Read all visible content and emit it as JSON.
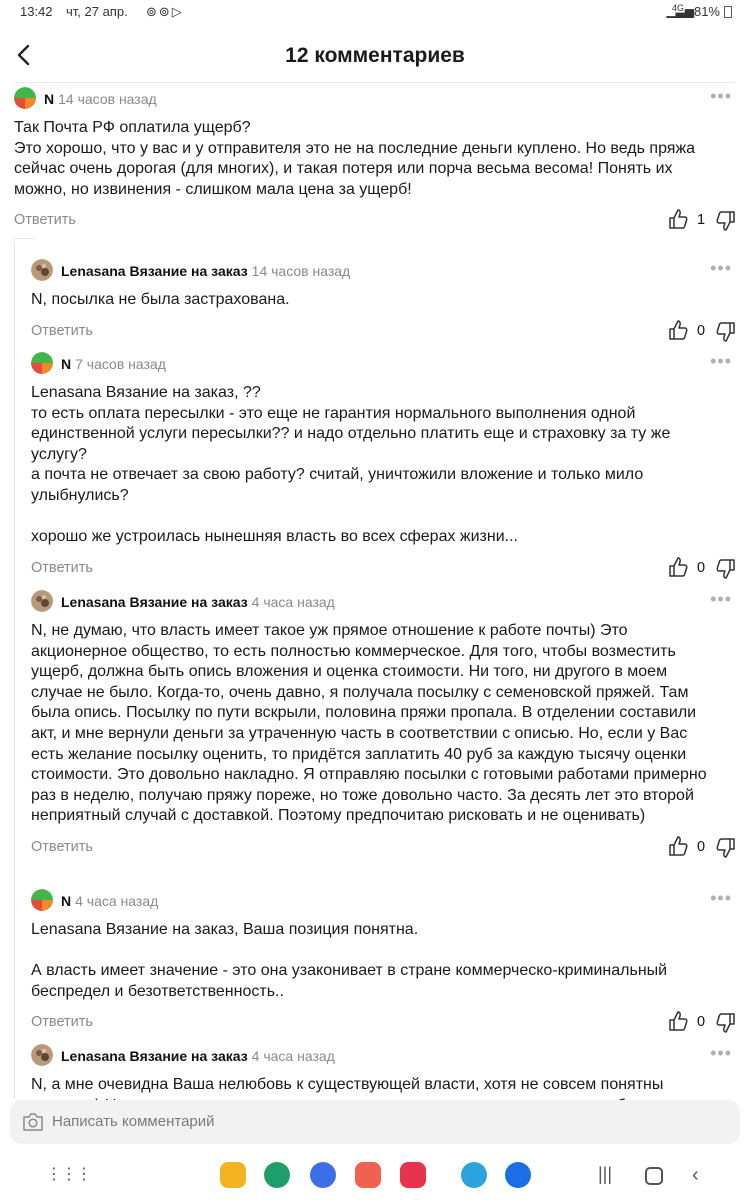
{
  "status_bar": {
    "time": "13:42",
    "date": "чт, 27 апр.",
    "battery": "81%",
    "network": "4G"
  },
  "header": {
    "title": "12 комментариев"
  },
  "comments": [
    {
      "author": "N",
      "time": "14 часов назад",
      "text": "Так Почта РФ оплатила ущерб?\nЭто хорошо, что у вас и у отправителя это не на последние деньги куплено. Но ведь пряжа сейчас очень дорогая (для многих), и такая потеря или порча весьма весома! Понять их можно, но извинения - слишком мала цена за ущерб!",
      "reply": "Ответить",
      "likes": "1"
    },
    {
      "author": "Lenasana Вязание на заказ",
      "time": "14 часов назад",
      "text": "N, посылка  не была застрахована.",
      "reply": "Ответить",
      "likes": "0"
    },
    {
      "author": "N",
      "time": "7 часов назад",
      "text": "Lenasana Вязание на заказ, ??\nто есть оплата пересылки - это еще не гарантия нормального выполнения одной единственной услуги пересылки?? и надо отдельно платить еще и страховку за ту же услугу?\nа почта не отвечает за свою работу? считай, уничтожили вложение и только мило улыбнулись?\n\nхорошо же устроилась нынешняя власть во всех сферах жизни...",
      "reply": "Ответить",
      "likes": "0"
    },
    {
      "author": "Lenasana Вязание на заказ",
      "time": "4 часа назад",
      "text": "N, не думаю, что власть имеет такое уж прямое отношение к работе почты) Это акционерное общество,  то есть полностью коммерческое. Для того,  чтобы возместить ущерб, должна быть опись вложения и оценка стоимости.  Ни того, ни другого в моем случае не было. Когда-то,  очень давно, я получала посылку с семеновской пряжей. Там была опись. Посылку по пути вскрыли, половина пряжи пропала. В отделении составили акт, и мне вернули деньги за утраченную часть в соответствии с описью. Но, если у Вас есть желание посылку оценить,  то придётся заплатить 40 руб за каждую тысячу оценки стоимости. Это довольно накладно. Я отправляю посылки с готовыми работами примерно раз в неделю,  получаю пряжу пореже, но тоже довольно часто. За десять лет это второй неприятный случай с доставкой. Поэтому предпочитаю рисковать и не оценивать)",
      "reply": "Ответить",
      "likes": "0"
    },
    {
      "author": "N",
      "time": "4 часа назад",
      "text": "Lenasana Вязание на заказ, Ваша позиция понятна.\n\nА власть имеет значение - это она узаконивает в стране коммерческо-криминальный беспредел и безответственность..",
      "reply": "Ответить",
      "likes": "0"
    },
    {
      "author": "Lenasana Вязание на заказ",
      "time": "4 часа назад",
      "text": "N, а мне очевидна Ваша нелюбовь к существующей власти, хотя не совсем понятны причины) Но то, что почта - это не государство, а частная компания, которая обслуживается финансово по их обязательствам. Конкретно в моем случае никакого  криминального",
      "reply": "",
      "likes": ""
    }
  ],
  "input": {
    "placeholder": "Написать комментарий"
  },
  "icons": {
    "back": "back-arrow-icon",
    "like": "thumb-up-icon",
    "dislike": "thumb-down-icon",
    "more": "more-dots-icon",
    "camera": "camera-icon"
  },
  "colors": {
    "accent_green": "#43b649",
    "accent_orange": "#f08a2b",
    "muted_text": "#8a8a8a"
  }
}
